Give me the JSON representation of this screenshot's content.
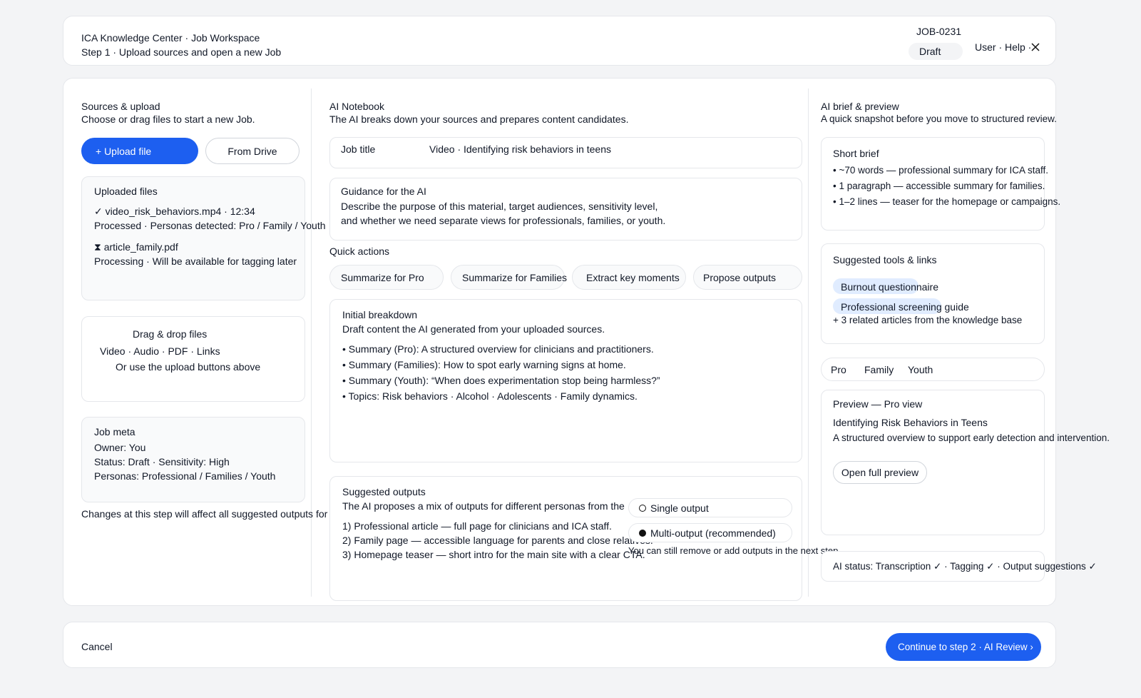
{
  "header": {
    "app_title": "ICA Knowledge Center · Job Workspace",
    "step_title": "Step 1 · Upload sources and open a new Job",
    "job_id": "JOB-0231",
    "status_badge": "Draft",
    "user_links": "User · Help ·"
  },
  "sources": {
    "title": "Sources & upload",
    "subtitle": "Choose or drag files to start a new Job.",
    "upload_label": "+ Upload file",
    "drive_label": "From Drive",
    "uploaded_title": "Uploaded files",
    "files": [
      {
        "name": "✓ video_risk_behaviors.mp4 · 12:34",
        "status": "Processed · Personas detected: Pro / Family / Youth"
      },
      {
        "name": "⧗ article_family.pdf",
        "status": "Processing · Will be available for tagging later"
      }
    ],
    "drop_title": "Drag & drop files",
    "drop_types": "Video · Audio · PDF · Links",
    "drop_hint": "Or use the upload buttons above",
    "meta_title": "Job meta",
    "meta_owner": "Owner: You",
    "meta_status": "Status: Draft · Sensitivity: High",
    "meta_personas": "Personas: Professional / Families / Youth",
    "footnote": "Changes at this step will affect all suggested outputs for"
  },
  "notebook": {
    "title": "AI Notebook",
    "subtitle": "The AI breaks down your sources and prepares content candidates.",
    "job_title_label": "Job title",
    "job_title_value": "Video · Identifying risk behaviors in teens",
    "guidance_title": "Guidance for the AI",
    "guidance_line1": "Describe the purpose of this material, target audiences, sensitivity level,",
    "guidance_line2": "and whether we need separate views for professionals, families, or youth.",
    "quick_actions_title": "Quick actions",
    "quick_actions": [
      "Summarize for Pro",
      "Summarize for Families",
      "Extract key moments",
      "Propose outputs"
    ],
    "breakdown_title": "Initial breakdown",
    "breakdown_subtitle": "Draft content the AI generated from your uploaded sources.",
    "breakdown_items": [
      "• Summary (Pro): A structured overview for clinicians and practitioners.",
      "• Summary (Families): How to spot early warning signs at home.",
      "• Summary (Youth): “When does experimentation stop being harmless?”",
      "• Topics: Risk behaviors · Alcohol · Adolescents · Family dynamics."
    ],
    "outputs_title": "Suggested outputs",
    "outputs_subtitle": "The AI proposes a mix of outputs for different personas from the",
    "outputs_items": [
      "1) Professional article — full page for clinicians and ICA staff.",
      "2) Family page — accessible language for parents and close relatives.",
      "3) Homepage teaser — short intro for the main site with a clear CTA."
    ],
    "option_single": "Single output",
    "option_multi": "Multi-output (recommended)",
    "outputs_note": "You can still remove or add outputs in the next step."
  },
  "brief": {
    "title": "AI brief & preview",
    "subtitle": "A quick snapshot before you move to structured review.",
    "short_brief_title": "Short brief",
    "short_brief_items": [
      "• ~70 words — professional summary for ICA staff.",
      "• 1 paragraph — accessible summary for families.",
      "• 1–2 lines — teaser for the homepage or campaigns."
    ],
    "tools_title": "Suggested tools & links",
    "tools": [
      "Burnout questionnaire",
      "Professional screening guide"
    ],
    "tools_more": "+ 3 related articles from the knowledge base",
    "persona_tabs": [
      "Pro",
      "Family",
      "Youth"
    ],
    "preview_title": "Preview — Pro view",
    "preview_heading": "Identifying Risk Behaviors in Teens",
    "preview_text": "A structured overview to support early detection and intervention.",
    "preview_button": "Open full preview",
    "ai_status": "AI status: Transcription ✓ · Tagging ✓ · Output suggestions ✓"
  },
  "footer": {
    "cancel_label": "Cancel",
    "continue_label": "Continue to step 2 · AI Review ›"
  },
  "colors": {
    "primary": "#1d5ff0",
    "chip": "#e0ecff"
  }
}
